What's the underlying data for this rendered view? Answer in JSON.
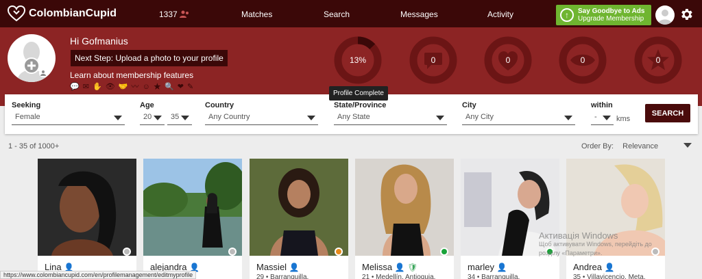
{
  "header": {
    "brand": "ColombianCupid",
    "count": "1337",
    "nav": [
      "Matches",
      "Search",
      "Messages",
      "Activity"
    ],
    "upgrade_line1": "Say Goodbye to Ads",
    "upgrade_line2": "Upgrade Membership"
  },
  "hero": {
    "greeting": "Hi Gofmanius",
    "next_step": "Next Step: Upload a photo to your profile",
    "learn": "Learn about membership features",
    "feature_icons": "💬 ✉ ✋ 👁 🤝 〰 ☺ ★ 🔍 ❤ ✎",
    "stats": [
      {
        "value": "13%",
        "progress": 0.13,
        "icon": "progress-ring"
      },
      {
        "value": "0",
        "icon": "message-icon"
      },
      {
        "value": "0",
        "icon": "heart-icon"
      },
      {
        "value": "0",
        "icon": "eye-icon"
      },
      {
        "value": "0",
        "icon": "star-icon"
      }
    ],
    "tooltip": "Profile Complete"
  },
  "search": {
    "seeking_label": "Seeking",
    "seeking_value": "Female",
    "age_label": "Age",
    "age_min": "20",
    "age_max": "35",
    "country_label": "Country",
    "country_value": "Any Country",
    "state_label": "State/Province",
    "state_value": "Any State",
    "city_label": "City",
    "city_value": "Any City",
    "within_label": "within",
    "within_value": "-",
    "within_unit": "kms",
    "button": "SEARCH"
  },
  "results": {
    "count_text": "1 - 35 of 1000+",
    "order_label": "Order By:",
    "order_value": "Relevance"
  },
  "cards": [
    {
      "name": "Lina",
      "meta": "",
      "status": "#bbbbbb"
    },
    {
      "name": "alejandra",
      "meta": "",
      "status": "#bbbbbb"
    },
    {
      "name": "Massiel",
      "meta": "29 • Barranquilla,",
      "status": "#e88a1a"
    },
    {
      "name": "Melissa",
      "meta": "21 • Medellín, Antioquia,",
      "status": "#1aa33a"
    },
    {
      "name": "marley",
      "meta": "34 • Barranquilla,",
      "status": "#1aa33a"
    },
    {
      "name": "Andrea",
      "meta": "35 • Villavicencio, Meta,",
      "status": "#bbbbbb"
    }
  ],
  "statusbar_url": "https://www.colombiancupid.com/en/profilemanagement/editmyprofile",
  "watermark_line1": "Активація Windows",
  "watermark_line2": "Щоб активувати Windows, перейдіть до",
  "watermark_line3": "розділу «Параметри».",
  "colors": {
    "topbar": "#3b0808",
    "hero": "#8c2424",
    "accent_green": "#6fb530",
    "button": "#4a0b0b"
  }
}
